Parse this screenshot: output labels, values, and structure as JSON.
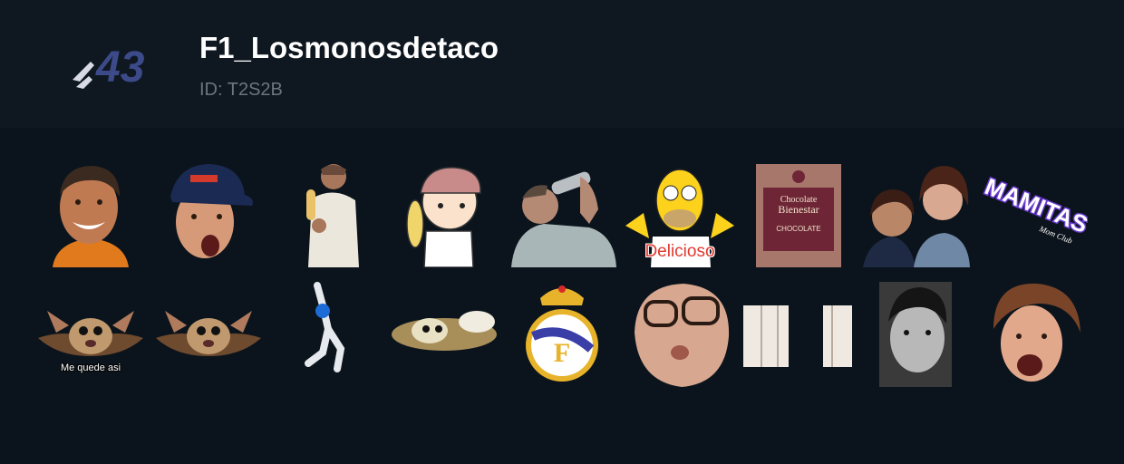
{
  "pack": {
    "title": "F1_Losmonosdetaco",
    "id_label": "ID: T2S2B",
    "icon_text": "43",
    "icon_name": "number-43-logo-icon"
  },
  "stickers": [
    {
      "row": 1,
      "name": "sticker-smiling-man-orange-shirt",
      "caption": ""
    },
    {
      "row": 1,
      "name": "sticker-driver-cap-shocked",
      "caption": ""
    },
    {
      "row": 1,
      "name": "sticker-man-holding-corn",
      "caption": ""
    },
    {
      "row": 1,
      "name": "sticker-cartoon-boy-corn",
      "caption": ""
    },
    {
      "row": 1,
      "name": "sticker-man-drinking-bottle",
      "caption": ""
    },
    {
      "row": 1,
      "name": "sticker-homer-delicioso",
      "caption": "Delicioso"
    },
    {
      "row": 1,
      "name": "sticker-chocolate-box",
      "caption": "",
      "box_text": [
        "Chocolate",
        "Bienestar",
        "CHOCOLATE"
      ]
    },
    {
      "row": 1,
      "name": "sticker-two-women",
      "caption": ""
    },
    {
      "row": 1,
      "name": "sticker-mamitas-text",
      "caption": "",
      "art_text": [
        "MAMITAS",
        "Mom Club"
      ]
    },
    {
      "row": 2,
      "name": "sticker-gremlin-me-quede-asi",
      "caption": "Me quede asi"
    },
    {
      "row": 2,
      "name": "sticker-gremlin",
      "caption": ""
    },
    {
      "row": 2,
      "name": "sticker-astronaut-figure",
      "caption": ""
    },
    {
      "row": 2,
      "name": "sticker-gremlin-lying",
      "caption": ""
    },
    {
      "row": 2,
      "name": "sticker-real-madrid-crest",
      "caption": ""
    },
    {
      "row": 2,
      "name": "sticker-man-glasses-face",
      "caption": ""
    },
    {
      "row": 2,
      "name": "sticker-paper-strips",
      "caption": ""
    },
    {
      "row": 2,
      "name": "sticker-bw-young-man",
      "caption": ""
    },
    {
      "row": 2,
      "name": "sticker-curly-hair-laughing",
      "caption": ""
    }
  ],
  "colors": {
    "header_bg": "#0f1820",
    "grid_bg": "#0b141c",
    "title": "#ffffff",
    "id_text": "#6c757c",
    "logo": "#3c4a8a",
    "caption_red": "#e0392f"
  }
}
